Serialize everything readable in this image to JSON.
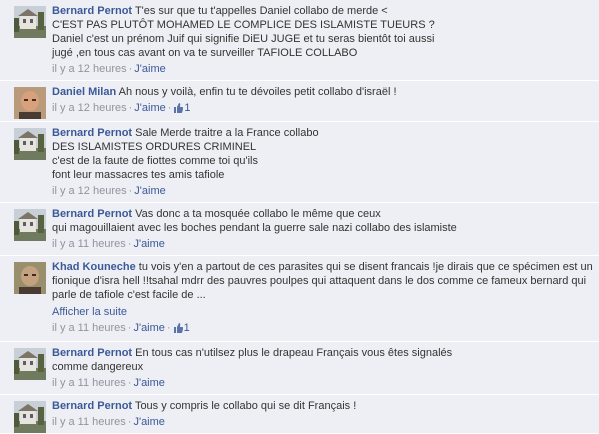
{
  "time_label": "il y a 12 heures",
  "time_label_11": "il y a 11 heures",
  "like_label": "J'aime",
  "separator": "·",
  "comments": [
    {
      "author": "Bernard Pernot",
      "avatar_icon": "house-photo-icon",
      "lines": [
        "T'es sur que tu t'appelles Daniel collabo de merde <",
        "C'EST PAS PLUTÔT MOHAMED LE COMPLICE DES ISLAMISTE TUEURS ?",
        "Daniel c'est un prénom Juif qui signifie DiEU JUGE et tu seras bientôt toi aussi",
        "jugé ,en tous cas avant on va te surveiller TAFIOLE COLLABO"
      ],
      "time": "il y a 12 heures",
      "likes": ""
    },
    {
      "author": "Daniel Milan",
      "avatar_icon": "person-photo-icon",
      "lines": [
        "Ah nous y voilà, enfin tu te dévoiles petit collabo d'israël !"
      ],
      "time": "il y a 12 heures",
      "likes": "1"
    },
    {
      "author": "Bernard Pernot",
      "avatar_icon": "house-photo-icon",
      "lines": [
        "Sale Merde traitre a la France collabo",
        "DES ISLAMISTES ORDURES CRIMINEL",
        "c'est de la faute de fiottes comme toi qu'ils",
        "font leur massacres tes amis tafiole"
      ],
      "time": "il y a 12 heures",
      "likes": ""
    },
    {
      "author": "Bernard Pernot",
      "avatar_icon": "house-photo-icon",
      "lines": [
        "Vas donc a ta mosquée collabo le même que ceux",
        "qui magouillaient avec les boches pendant la guerre sale nazi collabo des islamiste"
      ],
      "time": "il y a 11 heures",
      "likes": ""
    },
    {
      "author": "Khad Kouneche",
      "avatar_icon": "person-photo-icon",
      "lines": [
        "tu vois y'en a partout de ces parasites qui se disent francais !je dirais que ce spécimen est un",
        "fionique d'isra hell !!tsahal mdrr des pauvres poulpes qui attaquent dans le dos comme ce fameux bernard qui",
        "parle de tafiole c'est facile de ..."
      ],
      "see_more": "Afficher la suite",
      "time": "il y a 11 heures",
      "likes": "1"
    },
    {
      "author": "Bernard Pernot",
      "avatar_icon": "house-photo-icon",
      "lines": [
        "En tous cas n'utilsez plus le drapeau Français vous êtes signalés",
        "comme dangereux"
      ],
      "time": "il y a 11 heures",
      "likes": ""
    },
    {
      "author": "Bernard Pernot",
      "avatar_icon": "house-photo-icon",
      "lines": [
        "Tous y compris le collabo qui se dit Français !"
      ],
      "time": "il y a 11 heures",
      "likes": ""
    }
  ],
  "colors": {
    "link": "#3b5998",
    "background": "#edeff4",
    "meta": "#90949c"
  }
}
